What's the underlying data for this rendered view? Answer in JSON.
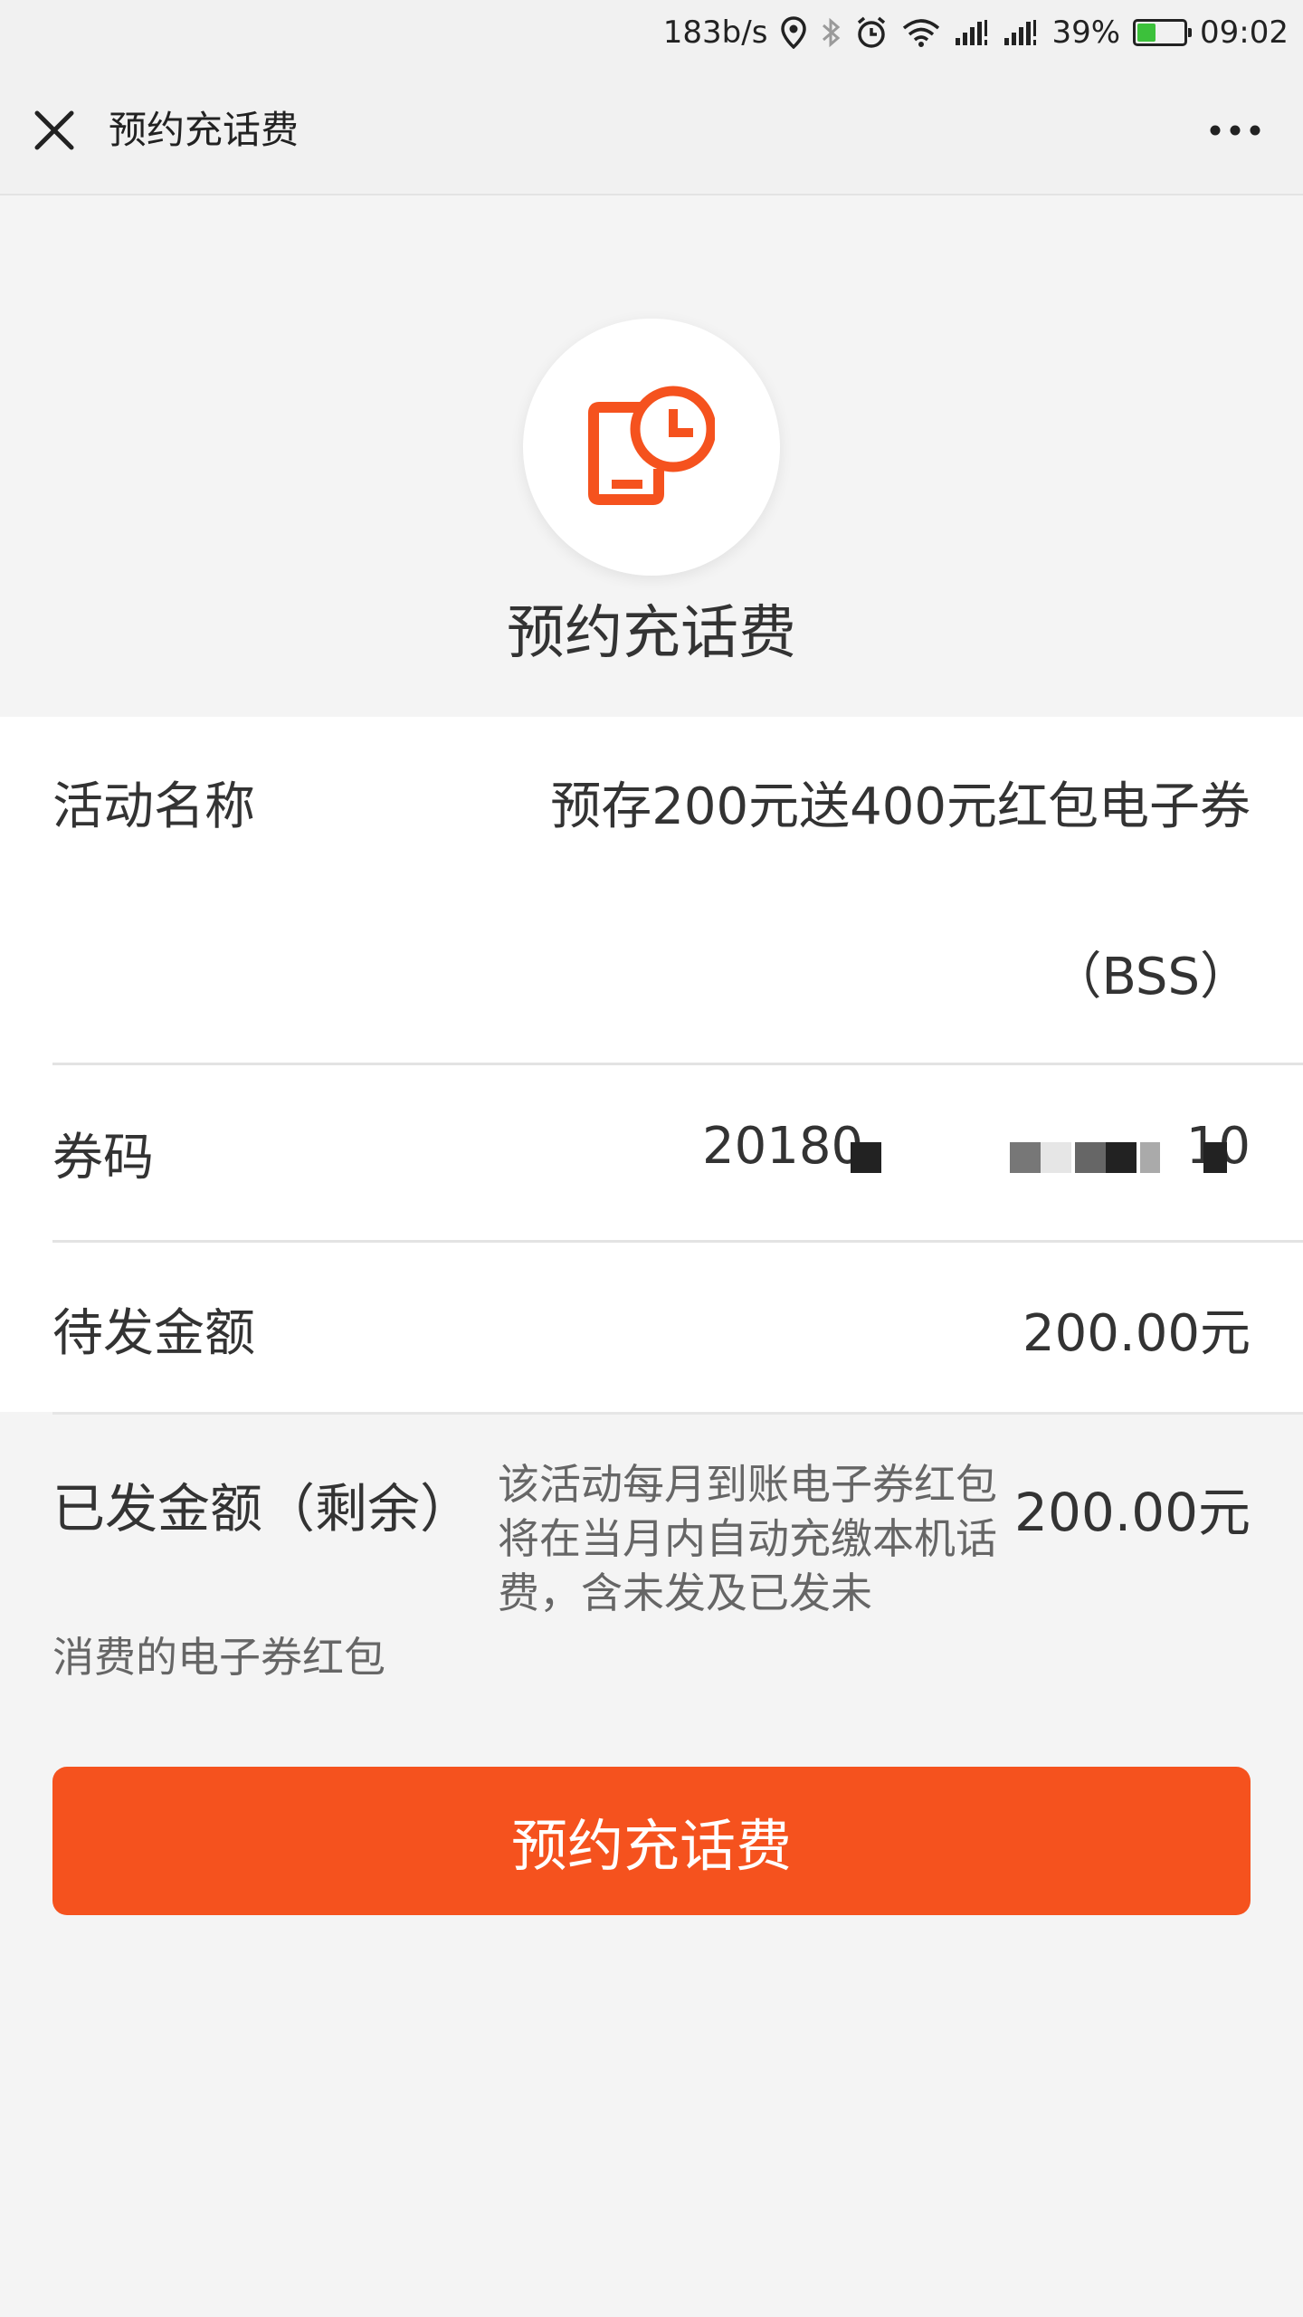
{
  "status_bar": {
    "net_speed": "183b/s",
    "battery_percent": "39%",
    "battery_level": 0.39,
    "time": "09:02",
    "icons": [
      "location-icon",
      "bluetooth-icon",
      "alarm-icon",
      "wifi-icon",
      "signal-icon",
      "signal-icon",
      "battery-icon"
    ]
  },
  "nav": {
    "title": "预约充话费",
    "close_icon": "close-icon",
    "more_icon": "more-icon"
  },
  "hero": {
    "icon": "phone-clock-icon",
    "title": "预约充话费",
    "accent_color": "#f5521e"
  },
  "details": {
    "activity_label": "活动名称",
    "activity_value_line1": "预存200元送400元红包电子券",
    "activity_value_line2": "（BSS）",
    "code_label": "券码",
    "code_prefix": "20180",
    "code_suffix": "10",
    "pending_label": "待发金额",
    "pending_value": "200.00元"
  },
  "issued": {
    "label": "已发金额（剩余）",
    "note": "该活动每月到账电子券红包将在当月内自动充缴本机话费，含未发及已发未",
    "note_tail": "消费的电子券红包",
    "value": "200.00元"
  },
  "action": {
    "button_label": "预约充话费",
    "button_color": "#f5521e"
  }
}
